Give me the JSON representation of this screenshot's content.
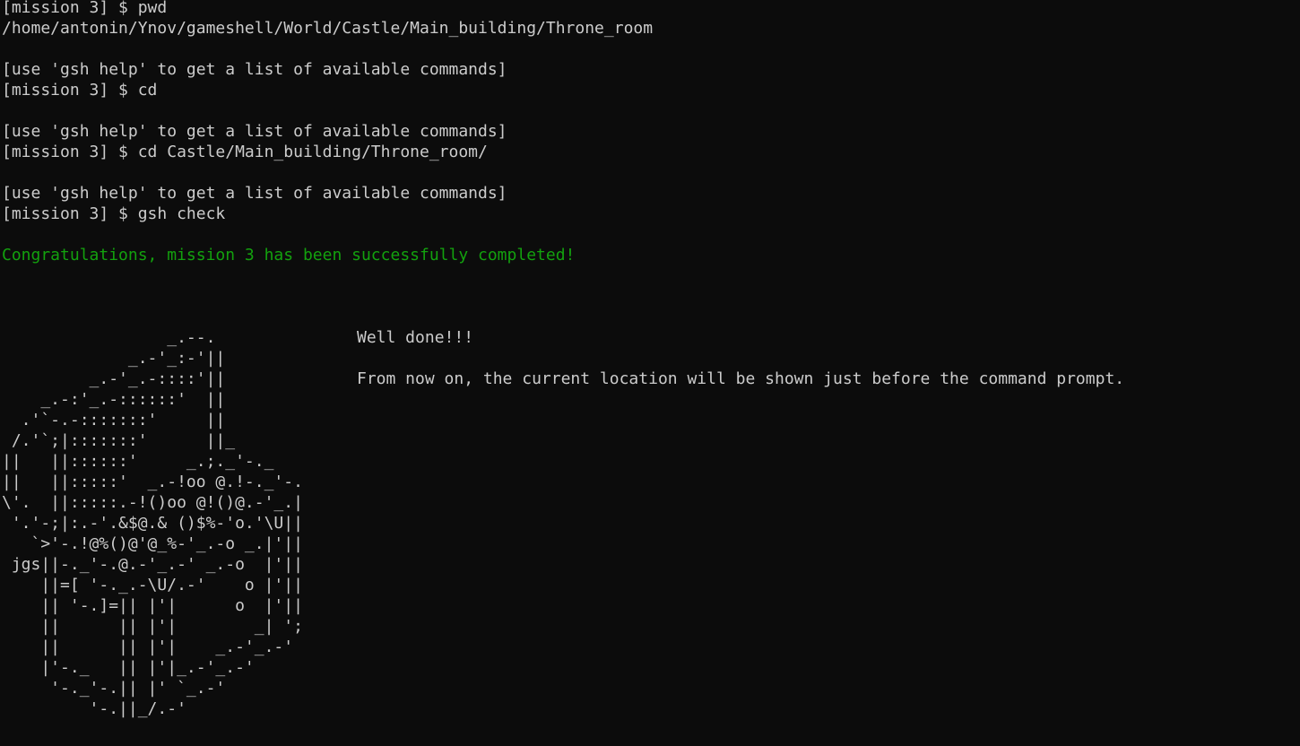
{
  "terminal": {
    "colors": {
      "background": "#0c0c0c",
      "foreground": "#cccccc",
      "success": "#13a10e"
    },
    "lines": [
      "[mission 3] $ pwd",
      "/home/antonin/Ynov/gameshell/World/Castle/Main_building/Throne_room",
      "",
      "[use 'gsh help' to get a list of available commands]",
      "[mission 3] $ cd",
      "",
      "[use 'gsh help' to get a list of available commands]",
      "[mission 3] $ cd Castle/Main_building/Throne_room/",
      "",
      "[use 'gsh help' to get a list of available commands]",
      "[mission 3] $ gsh check",
      "",
      "Congratulations, mission 3 has been successfully completed!"
    ],
    "ascii_art": "                 _.--.\n             _.-'_:-'||\n         _.-'_.-::::'||\n    _.-:'_.-::::::'  ||\n  .'`-.-:::::::'     ||\n /.'`;|:::::::'      ||_\n||   ||::::::'     _.;._'-._\n||   ||:::::'  _.-!oo @.!-._'-.\n\\'.  ||:::::.-!()oo @!()@.-'_.|\n '.'-;|:.-'.&$@.& ()$%-'o.'\\U||\n   `>'-.!@%()@'@_%-'_.-o _.|'||\n jgs||-._'-.@.-'_.-' _.-o  |'||\n    ||=[ '-._.-\\U/.-'    o |'||\n    || '-.]=|| |'|      o  |'||\n    ||      || |'|        _| ';\n    ||      || |'|    _.-'_.-'\n    |'-._   || |'|_.-'_.-'\n     '-._'-.|| |' `_.-'\n         '-.||_/.-'",
    "messages": [
      "Well done!!!",
      "From now on, the current location will be shown just before the command prompt."
    ]
  }
}
